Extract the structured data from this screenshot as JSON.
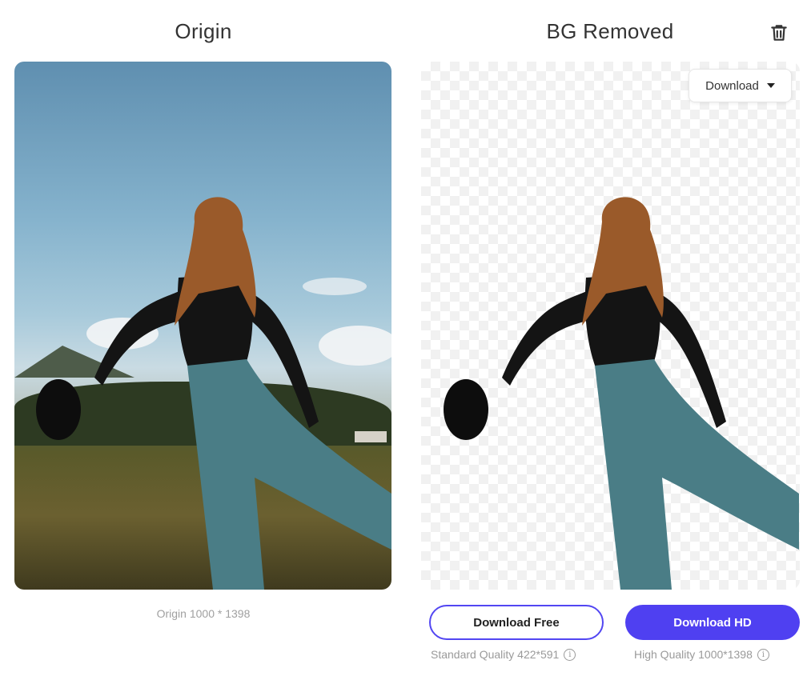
{
  "left": {
    "title": "Origin",
    "dimensions": "Origin 1000 * 1398"
  },
  "right": {
    "title": "BG Removed",
    "dropdown_label": "Download",
    "free_button": "Download Free",
    "hd_button": "Download HD",
    "standard_quality": "Standard Quality 422*591",
    "high_quality": "High Quality 1000*1398"
  },
  "icons": {
    "delete": "trash-icon",
    "dropdown": "caret-down-icon",
    "info": "info-icon"
  },
  "colors": {
    "accent": "#4f40f1",
    "caption": "#a0a0a0"
  }
}
